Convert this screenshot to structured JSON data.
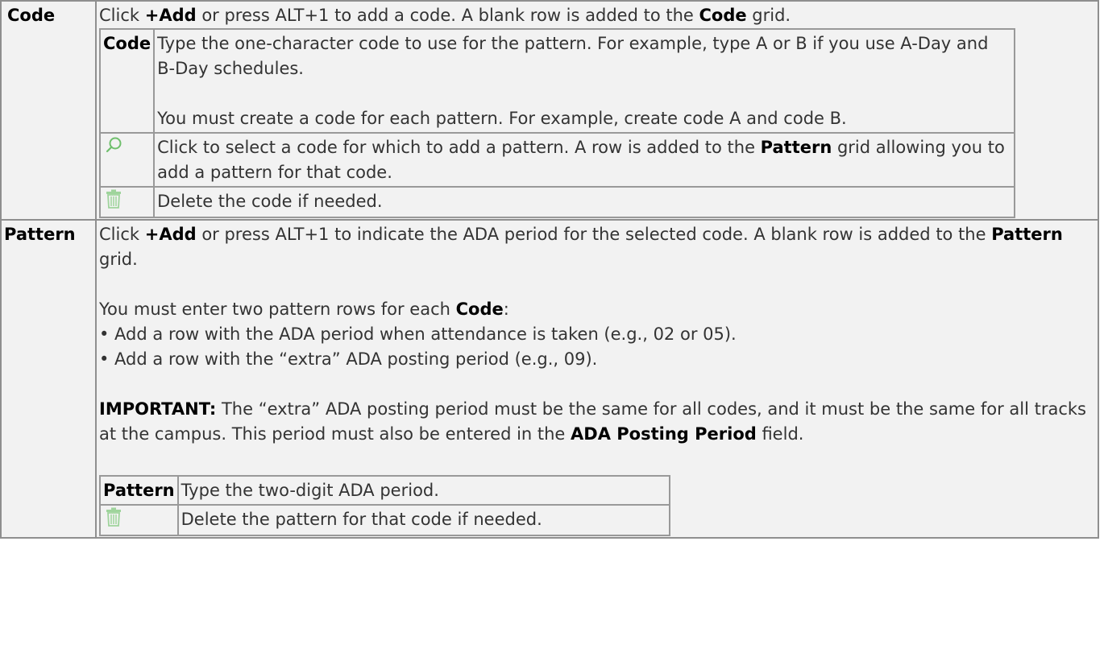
{
  "code_row": {
    "label": "Code",
    "intro_prefix": "Click ",
    "intro_add": "+Add",
    "intro_mid": " or press ALT+1 to add a code. A blank row is added to the ",
    "intro_bold": "Code",
    "intro_suffix": " grid.",
    "inner": {
      "code_label": "Code",
      "code_desc_1": "Type the one-character code to use for the pattern. For example, type A or B if you use A-Day and B-Day schedules.",
      "code_desc_2": "You must create a code for each pattern. For example, create code A and code B.",
      "search_icon": "search-icon",
      "search_desc_prefix": "Click to select a code for which to add a pattern. A row is added to the ",
      "search_desc_bold": "Pattern",
      "search_desc_suffix": " grid allowing you to add a pattern for that code.",
      "delete_icon": "trash-icon",
      "delete_desc": "Delete the code if needed."
    }
  },
  "pattern_row": {
    "label": "Pattern",
    "intro_prefix": "Click ",
    "intro_add": "+Add",
    "intro_mid": " or press ALT+1 to indicate the ADA period for the selected code. A blank row is added to the ",
    "intro_bold": "Pattern",
    "intro_suffix": " grid.",
    "must_prefix": "You must enter two pattern rows for each ",
    "must_bold": "Code",
    "must_suffix": ":",
    "bullet_1": "• Add a row with the ADA period when attendance is taken (e.g., 02 or 05).",
    "bullet_2": "• Add a row with the “extra” ADA posting period (e.g., 09).",
    "important_label": "IMPORTANT:",
    "important_text_1": " The “extra” ADA posting period must be the same for all codes, and it must be the same for all tracks at the campus. This period must also be entered in the ",
    "important_bold": "ADA Posting Period",
    "important_text_2": " field.",
    "inner": {
      "pattern_label": "Pattern",
      "pattern_desc": "Type the two-digit ADA period.",
      "delete_icon": "trash-icon",
      "delete_desc": "Delete the pattern for that code if needed."
    }
  },
  "colors": {
    "cell_bg": "#f2f2f2",
    "border": "#999999",
    "text": "#333333",
    "icon_green": "#8cc98a"
  }
}
